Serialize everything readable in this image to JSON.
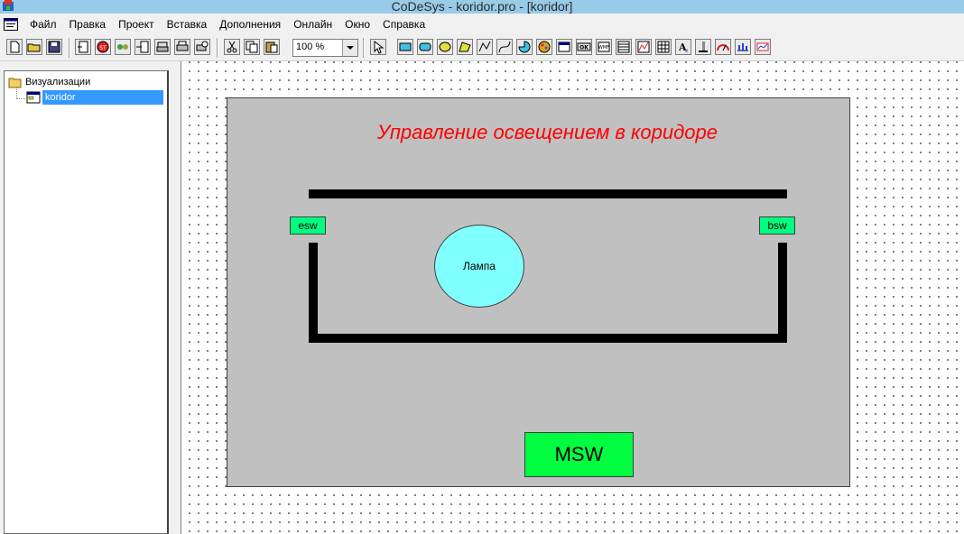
{
  "window": {
    "title": "CoDeSys - koridor.pro - [koridor]"
  },
  "menu": {
    "items": [
      "Файл",
      "Правка",
      "Проект",
      "Вставка",
      "Дополнения",
      "Онлайн",
      "Окно",
      "Справка"
    ]
  },
  "toolbar": {
    "zoom_value": "100 %",
    "ok_label": "OK",
    "wmf_label": "WMF"
  },
  "tree": {
    "root_label": "Визуализации",
    "child_label": "koridor"
  },
  "visualization": {
    "heading": "Управление освещением в коридоре",
    "esw_label": "esw",
    "bsw_label": "bsw",
    "lamp_label": "Лампа",
    "msw_label": "MSW",
    "colors": {
      "heading": "#ff0000",
      "panel": "#c0c0c0",
      "switch": "#00ff80",
      "lamp": "#80ffff",
      "msw": "#00ff40"
    }
  }
}
